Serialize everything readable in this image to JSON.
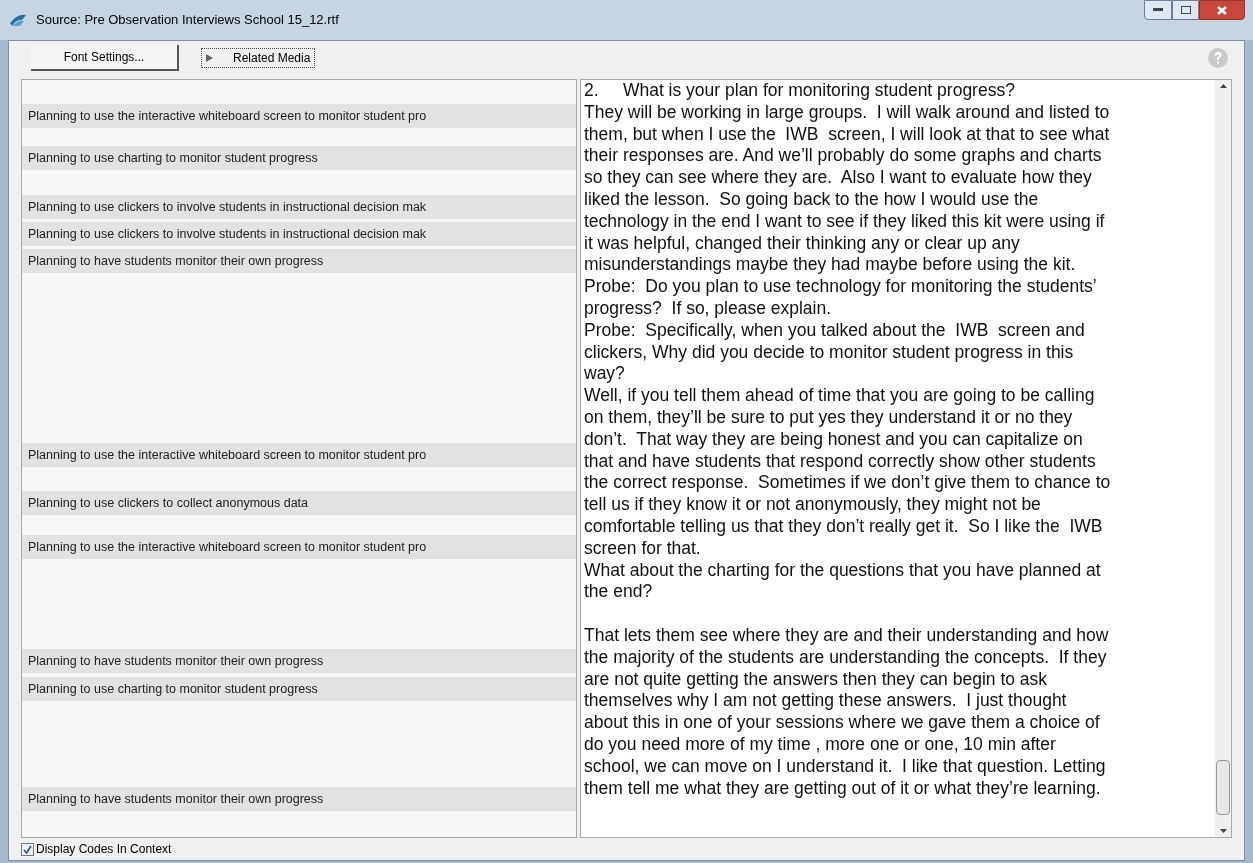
{
  "window": {
    "title": "Source: Pre Observation Interviews School 15_12.rtf"
  },
  "toolbar": {
    "font_button": "Font Settings...",
    "media_toggle": {
      "label": "Related Media",
      "expanded": false
    }
  },
  "codes": [
    {
      "label": "Planning to use the interactive whiteboard screen to monitor student pro"
    },
    {
      "label": "Planning to use charting to monitor student progress"
    },
    {
      "label": "Planning to use clickers to involve students in instructional decision mak"
    },
    {
      "label": "Planning to use clickers to involve students in instructional decision mak"
    },
    {
      "label": "Planning to have students monitor their own progress"
    },
    {
      "label": "Planning to use the interactive whiteboard screen to monitor student pro"
    },
    {
      "label": "Planning to use clickers to collect anonymous data"
    },
    {
      "label": "Planning to use the interactive whiteboard screen to monitor student pro"
    },
    {
      "label": "Planning to have students monitor their own progress"
    },
    {
      "label": "Planning to use charting to monitor student progress"
    },
    {
      "label": "Planning to have students monitor their own progress"
    }
  ],
  "document": {
    "paragraphs": [
      "2.     What is your plan for monitoring student progress?",
      "They will be working in large groups.  I will walk around and listed to them, but when I use the  IWB  screen, I will look at that to see what their responses are. And we’ll probably do some graphs and charts so they can see where they are.  Also I want to evaluate how they liked the lesson.  So going back to the how I would use the technology in the end I want to see if they liked this kit were using if it was helpful, changed their thinking any or clear up any misunderstandings maybe they had maybe before using the kit.",
      "Probe:  Do you plan to use technology for monitoring the students’ progress?  If so, please explain.",
      "Probe:  Specifically, when you talked about the  IWB  screen and clickers, Why did you decide to monitor student progress in this way?",
      "Well, if you tell them ahead of time that you are going to be calling on them, they’ll be sure to put yes they understand it or no they don’t.  That way they are being honest and you can capitalize on that and have students that respond correctly show other students the correct response.  Sometimes if we don’t give them to chance to tell us if they know it or not anonymously, they might not be comfortable telling us that they don’t really get it.  So I like the  IWB  screen for that.",
      "What about the charting for the questions that you have planned at the end?",
      "That lets them see where they are and their understanding and how the majority of the students are understanding the concepts.  If they are not quite getting the answers then they can begin to ask themselves why I am not getting these answers.  I just thought about this in one of your sessions where we gave them a choice of do you need more of my time , more one or one, 10 min after school, we can move on I understand it.  I like that question. Letting them tell me what they are getting out of it or what they’re learning."
    ]
  },
  "status": {
    "display_codes": {
      "label": "Display Codes In Context",
      "checked": true
    }
  }
}
